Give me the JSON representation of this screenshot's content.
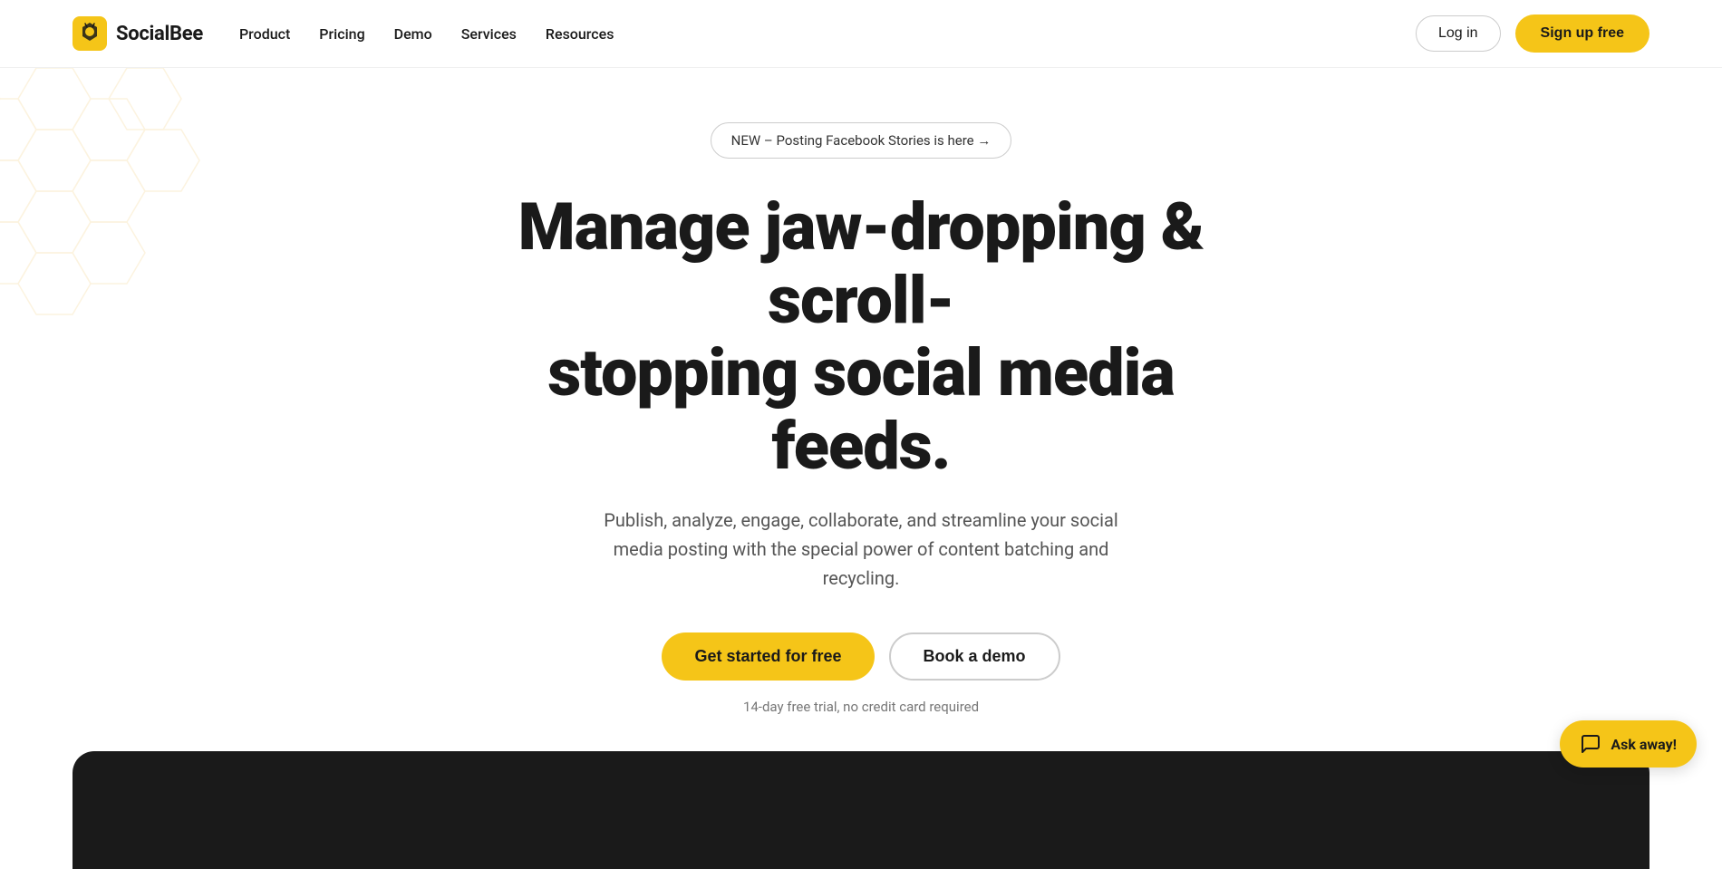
{
  "brand": {
    "name": "SocialBee",
    "logo_alt": "SocialBee logo"
  },
  "navbar": {
    "links": [
      {
        "label": "Product",
        "id": "product"
      },
      {
        "label": "Pricing",
        "id": "pricing"
      },
      {
        "label": "Demo",
        "id": "demo"
      },
      {
        "label": "Services",
        "id": "services"
      },
      {
        "label": "Resources",
        "id": "resources"
      }
    ],
    "login_label": "Log in",
    "signup_label": "Sign up free"
  },
  "hero": {
    "announcement": "NEW – Posting Facebook Stories is here →",
    "title_line1": "Manage jaw-dropping & scroll-",
    "title_line2": "stopping social media feeds.",
    "subtitle": "Publish, analyze, engage, collaborate, and streamline your social media posting with the special power of content batching and recycling.",
    "cta_primary": "Get started for free",
    "cta_secondary": "Book a demo",
    "trial_note": "14-day free trial, no credit card required"
  },
  "chat_widget": {
    "label": "Ask away!"
  },
  "colors": {
    "accent": "#f5c518",
    "dark": "#1a1a1a",
    "text_muted": "#555555",
    "border": "#cccccc"
  }
}
